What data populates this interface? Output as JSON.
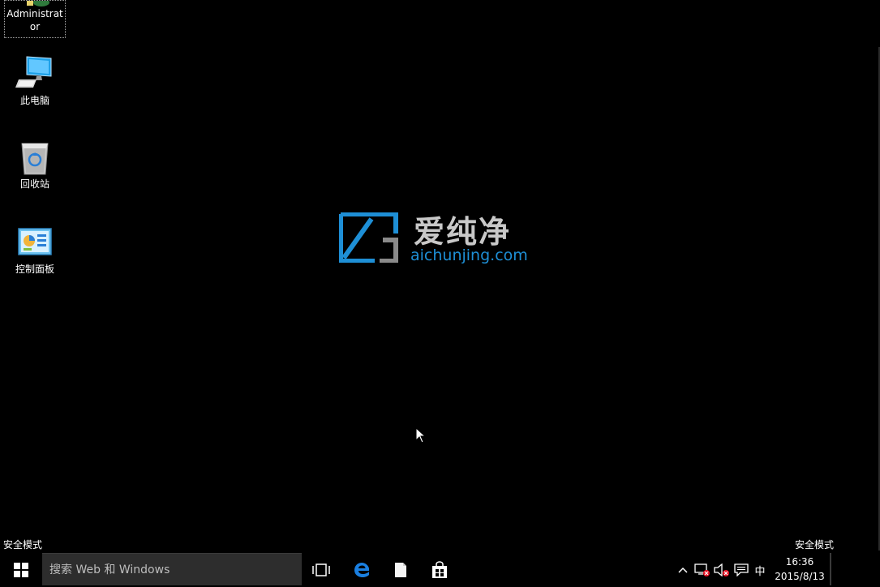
{
  "desktop": {
    "icons": [
      {
        "label": "Administrator",
        "icon": "user-folder-icon"
      },
      {
        "label": "此电脑",
        "icon": "computer-icon"
      },
      {
        "label": "回收站",
        "icon": "recycle-bin-icon"
      },
      {
        "label": "控制面板",
        "icon": "control-panel-icon"
      }
    ],
    "safe_mode_left": "安全模式",
    "safe_mode_right": "安全模式"
  },
  "watermark": {
    "title": "爱纯净",
    "url": "aichunjing.com",
    "accent_color": "#1e8fd6"
  },
  "taskbar": {
    "search_placeholder": "搜索 Web 和 Windows",
    "pinned": [
      "task-view-icon",
      "edge-icon",
      "file-explorer-icon",
      "store-icon"
    ],
    "tray": {
      "ime": "中",
      "time": "16:36",
      "date": "2015/8/13"
    }
  }
}
